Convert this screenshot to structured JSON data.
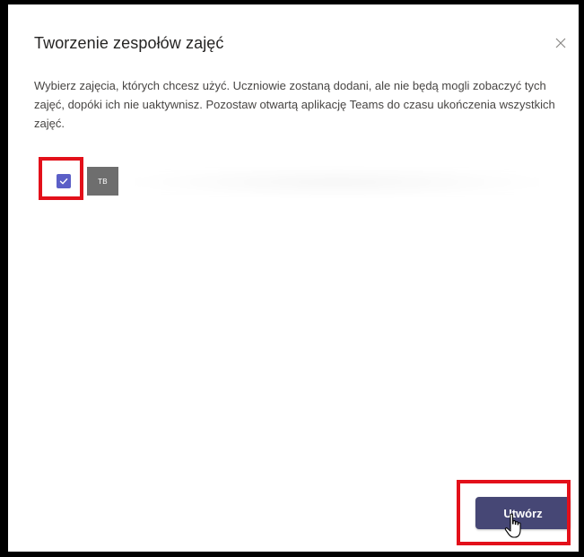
{
  "dialog": {
    "title": "Tworzenie zespołów zajęć",
    "description": "Wybierz zajęcia, których chcesz użyć. Uczniowie zostaną dodani, ale nie będą mogli zobaczyć tych zajęć, dopóki ich nie uaktywnisz. Pozostaw otwartą aplikację Teams do czasu ukończenia wszystkich zajęć.",
    "close_icon": "close-icon"
  },
  "class_row": {
    "checked": true,
    "avatar_initials": "TB",
    "checkbox_color": "#5b5fc7"
  },
  "actions": {
    "create_label": "Utwórz",
    "button_color": "#464775"
  },
  "annotations": {
    "highlight_color": "#e3101a"
  }
}
